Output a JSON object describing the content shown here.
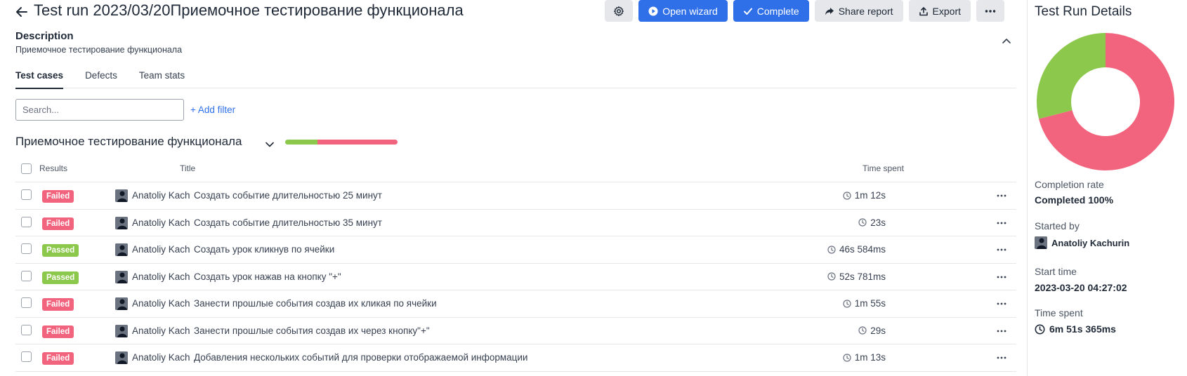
{
  "header": {
    "title": "Test run 2023/03/20Приемочное тестирование функционала",
    "buttons": {
      "open_wizard": "Open wizard",
      "complete": "Complete",
      "share_report": "Share report",
      "export": "Export"
    }
  },
  "description": {
    "label": "Description",
    "text": "Приемочное тестирование функционала"
  },
  "tabs": [
    {
      "label": "Test cases",
      "active": true
    },
    {
      "label": "Defects",
      "active": false
    },
    {
      "label": "Team stats",
      "active": false
    }
  ],
  "filters": {
    "search_placeholder": "Search...",
    "add_filter": "+ Add filter"
  },
  "suite": {
    "title": "Приемочное тестирование функционала",
    "passed_fraction": 0.29,
    "failed_fraction": 0.71
  },
  "table": {
    "columns": {
      "results": "Results",
      "title": "Title",
      "time": "Time spent"
    },
    "rows": [
      {
        "status": "Failed",
        "assignee": "Anatoliy Kachurin",
        "title": "Создать событие длительностью 25 минут",
        "time": "1m 12s"
      },
      {
        "status": "Failed",
        "assignee": "Anatoliy Kachurin",
        "title": "Создать событие длительностью 35 минут",
        "time": "23s"
      },
      {
        "status": "Passed",
        "assignee": "Anatoliy Kachurin",
        "title": "Создать урок кликнув по ячейки",
        "time": "46s 584ms"
      },
      {
        "status": "Passed",
        "assignee": "Anatoliy Kachurin",
        "title": "Создать урок нажав на кнопку \"+\"",
        "time": "52s 781ms"
      },
      {
        "status": "Failed",
        "assignee": "Anatoliy Kachurin",
        "title": "Занести прошлые события создав их кликая по ячейки",
        "time": "1m 55s"
      },
      {
        "status": "Failed",
        "assignee": "Anatoliy Kachurin",
        "title": "Занести прошлые события создав их через кнопку\"+\"",
        "time": "29s"
      },
      {
        "status": "Failed",
        "assignee": "Anatoliy Kachurin",
        "title": "Добавления нескольких событий для проверки отображаемой информации",
        "time": "1m 13s"
      }
    ]
  },
  "details": {
    "title": "Test Run Details",
    "chart": {
      "passed_fraction": 0.29,
      "failed_fraction": 0.71
    },
    "completion_label": "Completion rate",
    "completion_value": "Completed 100%",
    "started_by_label": "Started by",
    "started_by_value": "Anatoliy Kachurin",
    "start_time_label": "Start time",
    "start_time_value": "2023-03-20 04:27:02",
    "time_spent_label": "Time spent",
    "time_spent_value": "6m 51s 365ms"
  },
  "colors": {
    "passed": "#8cc84b",
    "failed": "#f2647e",
    "primary": "#2f6fe8"
  }
}
